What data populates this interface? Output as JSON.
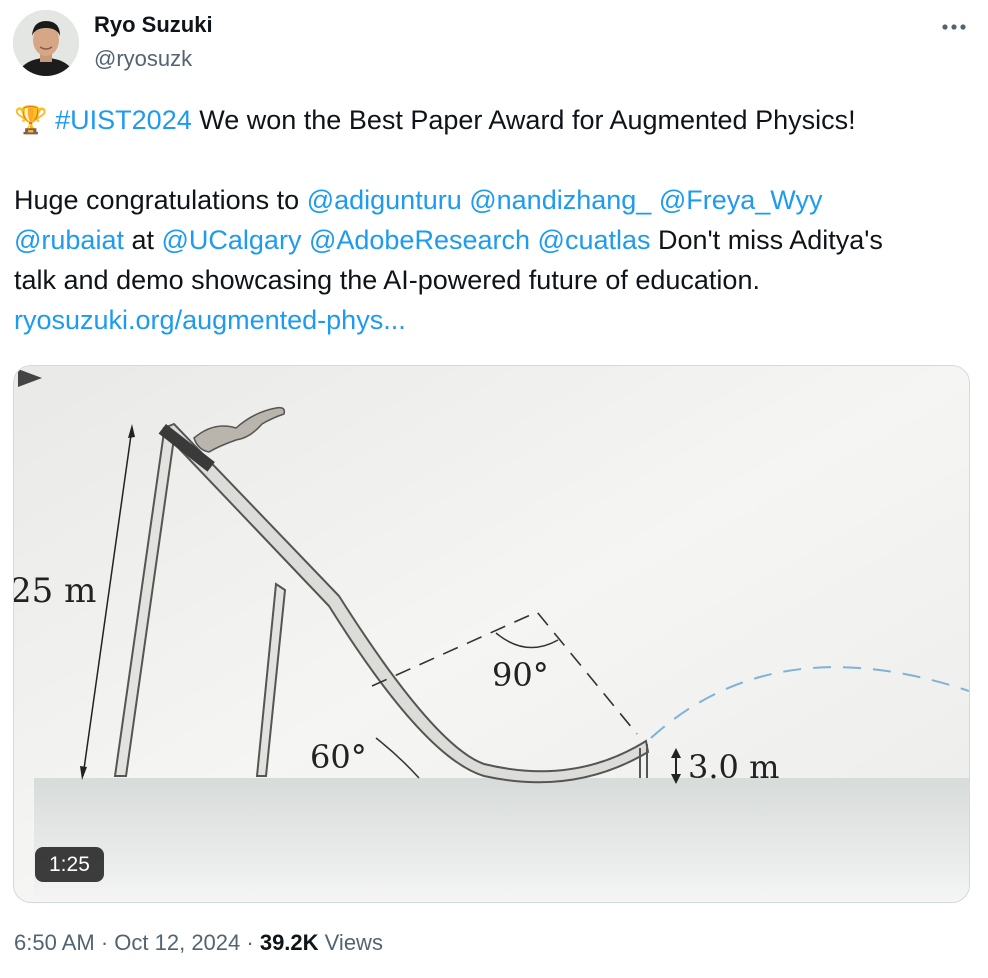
{
  "author": {
    "name": "Ryo Suzuki",
    "handle": "@ryosuzk"
  },
  "tweet": {
    "trophy_emoji": "🏆",
    "hashtag": "#UIST2024",
    "line1_rest": " We won the Best Paper Award for Augmented Physics!",
    "line2_prefix": "Huge congratulations to ",
    "mention_adigunturu": "@adigunturu",
    "mention_nandizhang": "@nandizhang_",
    "mention_freya": "@Freya_Wyy",
    "mention_rubaiat": "@rubaiat",
    "at_word": " at ",
    "mention_ucalgary": "@UCalgary",
    "mention_adobe": "@AdobeResearch",
    "mention_cuatlas": "@cuatlas",
    "line3_rest": " Don't miss Aditya's",
    "line4": "talk and demo showcasing the AI-powered future of education.",
    "link": "ryosuzuki.org/augmented-phys..."
  },
  "media": {
    "duration": "1:25",
    "label_height": "25 m",
    "label_angle_60": "60°",
    "label_angle_90": "90°",
    "label_end_height": "3.0 m"
  },
  "meta": {
    "time": "6:50 AM",
    "separator1": " · ",
    "date": "Oct 12, 2024",
    "separator2": " · ",
    "views_count": "39.2K",
    "views_label": " Views"
  },
  "icons": {
    "more": "more-horizontal-icon",
    "play": "play-icon",
    "trophy": "trophy-icon"
  },
  "colors": {
    "link": "#1d9bf0",
    "secondary_text": "#536471",
    "primary_text": "#0f1419",
    "dashed_trajectory": "#6fa8cf"
  }
}
